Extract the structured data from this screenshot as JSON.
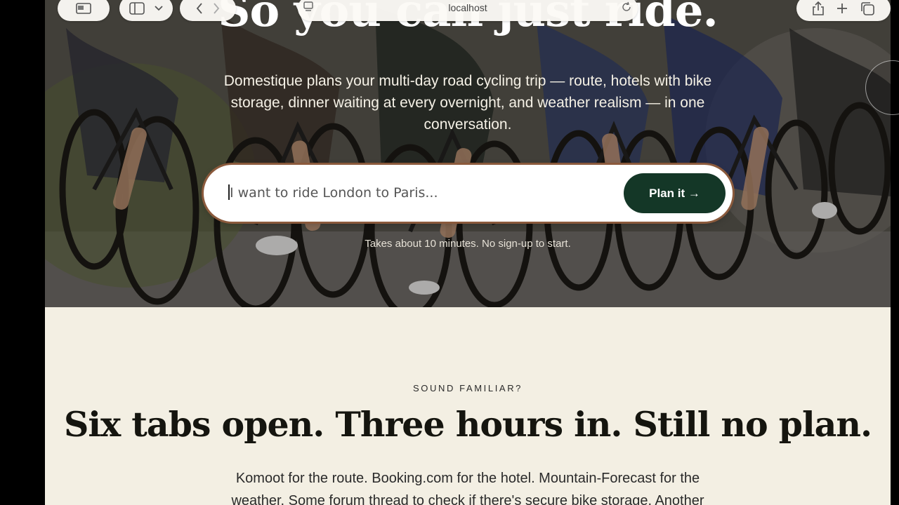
{
  "browser": {
    "url": "localhost",
    "icons": [
      "sidebar-toggle-icon",
      "chevron-down-icon",
      "back-arrow-icon",
      "forward-arrow-icon",
      "page-menu-icon",
      "reload-icon",
      "share-icon",
      "plus-icon",
      "tabs-icon"
    ]
  },
  "hero": {
    "title": "So you can just ride.",
    "subtitle": "Domestique plans your multi-day road cycling trip — route, hotels with bike storage, dinner waiting at every overnight, and weather realism — in one conversation.",
    "input_placeholder": "I want to ride London to Paris...",
    "button_label": "Plan it →",
    "note": "Takes about 10 minutes. No sign-up to start."
  },
  "section": {
    "eyebrow": "SOUND FAMILIAR?",
    "headline": "Six tabs open. Three hours in. Still no plan.",
    "body": "Komoot for the route. Booking.com for the hotel. Mountain-Forecast for the weather. Some forum thread to check if there's secure bike storage. Another"
  },
  "colors": {
    "accent": "#143727",
    "input_border": "#8b5a3c",
    "page_bg": "#f3efe3"
  }
}
